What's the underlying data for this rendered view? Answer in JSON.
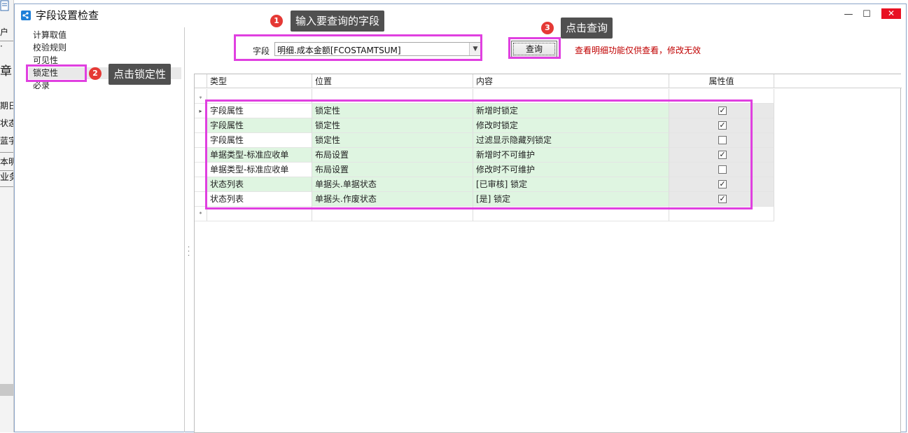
{
  "background_app": {
    "items": [
      "户",
      "·",
      "章",
      "期日",
      "状态",
      "蓝字",
      "本明",
      "业务"
    ]
  },
  "window": {
    "title": "字段设置检查",
    "min_label": "—",
    "max_label": "☐",
    "close_label": "✕"
  },
  "nav": {
    "items": [
      {
        "label": "计算取值",
        "selected": false
      },
      {
        "label": "校验规则",
        "selected": false
      },
      {
        "label": "可见性",
        "selected": false
      },
      {
        "label": "锁定性",
        "selected": true
      },
      {
        "label": "必录",
        "selected": false
      }
    ]
  },
  "filter": {
    "field_label": "字段",
    "field_value": "明细.成本金额[FCOSTAMTSUM]",
    "query_label": "查询",
    "notice": "查看明细功能仅供查看，修改无效"
  },
  "grid": {
    "columns": [
      "类型",
      "位置",
      "内容",
      "属性值"
    ],
    "rows": [
      {
        "type": "字段属性",
        "location": "锁定性",
        "content": "新增时锁定",
        "checked": true
      },
      {
        "type": "字段属性",
        "location": "锁定性",
        "content": "修改时锁定",
        "checked": true
      },
      {
        "type": "字段属性",
        "location": "锁定性",
        "content": "过滤显示隐藏列锁定",
        "checked": false
      },
      {
        "type": "单据类型-标准应收单",
        "location": "布局设置",
        "content": "新增时不可维护",
        "checked": true
      },
      {
        "type": "单据类型-标准应收单",
        "location": "布局设置",
        "content": "修改时不可维护",
        "checked": false
      },
      {
        "type": "状态列表",
        "location": "单据头.单据状态",
        "content": "[已审核] 锁定",
        "checked": true
      },
      {
        "type": "状态列表",
        "location": "单据头.作废状态",
        "content": "[是] 锁定",
        "checked": true
      }
    ],
    "filter_row_glyph": "ᵩ",
    "new_row_glyph": "*",
    "current_row_glyph": "▸"
  },
  "annotations": {
    "step1": {
      "number": "1",
      "text": "输入要查询的字段"
    },
    "step2": {
      "number": "2",
      "text": "点击锁定性"
    },
    "step3": {
      "number": "3",
      "text": "点击查询"
    }
  },
  "colors": {
    "highlight": "#e040e0",
    "badge": "#e53935",
    "callout": "#505050",
    "row_green": "#dff5e1",
    "notice_red": "#c00000"
  }
}
